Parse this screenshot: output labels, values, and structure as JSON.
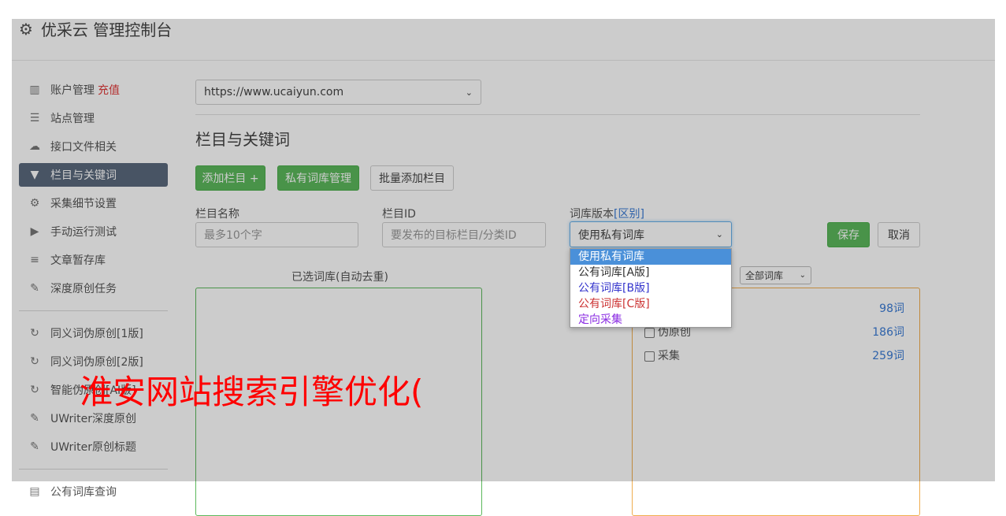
{
  "header": {
    "title": "优采云 管理控制台"
  },
  "sidebar": {
    "items": [
      {
        "label": "账户管理",
        "badge": "充值",
        "icon": "bar-chart-icon"
      },
      {
        "label": "站点管理",
        "icon": "server-icon"
      },
      {
        "label": "接口文件相关",
        "icon": "cloud-upload-icon"
      },
      {
        "label": "栏目与关键词",
        "icon": "filter-icon",
        "active": true
      },
      {
        "label": "采集细节设置",
        "icon": "gears-icon"
      },
      {
        "label": "手动运行测试",
        "icon": "play-circle-icon"
      },
      {
        "label": "文章暂存库",
        "icon": "database-icon"
      },
      {
        "label": "深度原创任务",
        "icon": "edit-icon"
      }
    ],
    "items2": [
      {
        "label": "同义词伪原创[1版]",
        "icon": "refresh-icon"
      },
      {
        "label": "同义词伪原创[2版]",
        "icon": "refresh-icon"
      },
      {
        "label": "智能伪原创[AI版]",
        "icon": "refresh-icon"
      },
      {
        "label": "UWriter深度原创",
        "icon": "edit-icon"
      },
      {
        "label": "UWriter原创标题",
        "icon": "edit-icon"
      }
    ],
    "items3": [
      {
        "label": "公有词库查询",
        "icon": "book-icon"
      }
    ]
  },
  "main": {
    "site_select": "https://www.ucaiyun.com",
    "section_title": "栏目与关键词",
    "buttons": {
      "add_column": "添加栏目 +",
      "private_lib": "私有词库管理",
      "batch_add": "批量添加栏目"
    },
    "form": {
      "name_label": "栏目名称",
      "name_placeholder": "最多10个字",
      "id_label": "栏目ID",
      "id_placeholder": "要发布的目标栏目/分类ID",
      "lib_label": "词库版本",
      "lib_link": "[区别]",
      "lib_selected": "使用私有词库",
      "save": "保存",
      "cancel": "取消"
    },
    "selected_lib_title": "已选词库(自动去重)",
    "lib_filter": "全部词库",
    "dropdown_options": [
      {
        "label": "使用私有词库",
        "color": "#ffffff"
      },
      {
        "label": "公有词库[A版]",
        "color": "#333333"
      },
      {
        "label": "公有词库[B版]",
        "color": "#3333cc"
      },
      {
        "label": "公有词库[C版]",
        "color": "#cc3333"
      },
      {
        "label": "定向采集",
        "color": "#8a2be2"
      }
    ],
    "library_rows": [
      {
        "label": "",
        "count": "98词"
      },
      {
        "label": "伪原创",
        "count": "186词"
      },
      {
        "label": "采集",
        "count": "259词"
      }
    ]
  },
  "watermark": "淮安网站搜索引擎优化("
}
